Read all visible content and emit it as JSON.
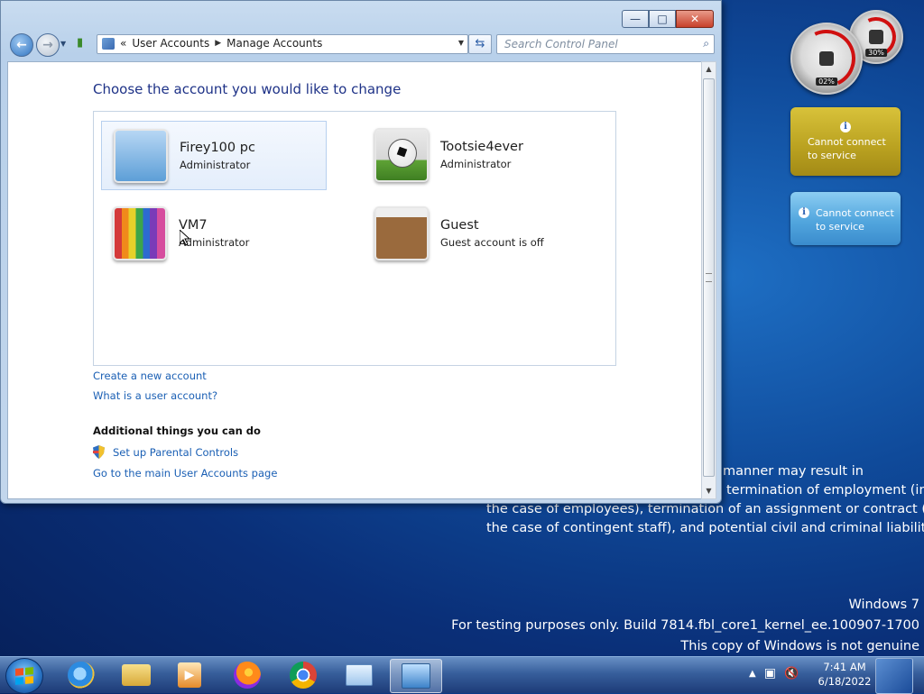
{
  "window": {
    "breadcrumb": [
      "User Accounts",
      "Manage Accounts"
    ],
    "breadcrumb_overflow": "«",
    "search_placeholder": "Search Control Panel",
    "caption_buttons": {
      "minimize": "—",
      "maximize": "□",
      "close": "✕"
    }
  },
  "main": {
    "heading": "Choose the account you would like to change",
    "accounts": [
      {
        "name": "Firey100 pc",
        "role": "Administrator",
        "picture": "roller-coaster",
        "selected": true
      },
      {
        "name": "Tootsie4ever",
        "role": "Administrator",
        "picture": "soccer-ball",
        "selected": false
      },
      {
        "name": "VM7",
        "role": "Administrator",
        "picture": "crayons",
        "selected": false
      },
      {
        "name": "Guest",
        "role": "Guest account is off",
        "picture": "suitcase",
        "selected": false
      }
    ],
    "links": {
      "create_account": "Create a new account",
      "what_is": "What is a user account?"
    },
    "additional_heading": "Additional things you can do",
    "parental_controls": "Set up Parental Controls",
    "main_page": "Go to the main User Accounts page"
  },
  "desktop": {
    "legal_lines": [
      "manner may result in",
      "termination of employment (in",
      "the case of employees), termination of an assignment or contract (in",
      "the case of contingent staff), and potential civil and criminal liability."
    ],
    "watermark": [
      "Windows 7",
      "For testing purposes only. Build 7814.fbl_core1_kernel_ee.100907-1700",
      "This copy of Windows is not genuine"
    ],
    "gadgets": {
      "cpu_percent": "02%",
      "memory_percent": "30%",
      "weather_message": "Cannot connect to service",
      "currency_message": "Cannot connect to service"
    }
  },
  "taskbar": {
    "apps": [
      "start",
      "internet-explorer",
      "file-explorer",
      "media-player",
      "firefox",
      "chrome",
      "user-card",
      "control-panel"
    ],
    "active_app": "control-panel",
    "clock": {
      "time": "7:41 AM",
      "date": "6/18/2022"
    },
    "tray_icons": [
      "show-hidden-arrow",
      "network-icon",
      "volume-muted-icon"
    ]
  }
}
